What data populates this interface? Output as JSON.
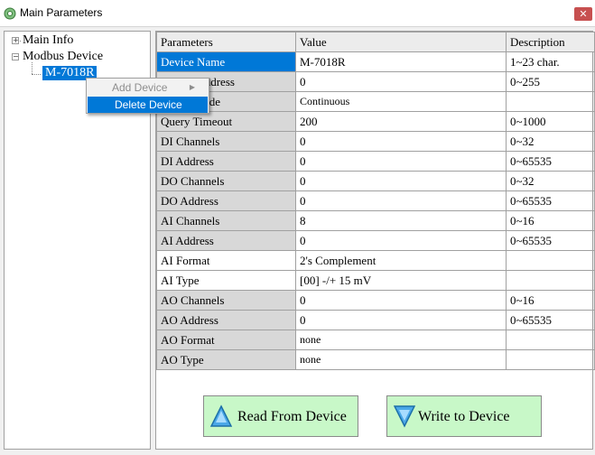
{
  "window": {
    "title": "Main Parameters",
    "close_glyph": "✕"
  },
  "tree": {
    "root_items": [
      "Main Info",
      "Modbus Device"
    ],
    "expander_collapsed": "+",
    "expander_expanded": "−",
    "selected_child": "M-7018R"
  },
  "context_menu": {
    "items": [
      {
        "label": "Add Device",
        "enabled": false,
        "submenu_arrow": "▶"
      },
      {
        "label": "Delete Device",
        "enabled": true,
        "highlighted": true
      }
    ]
  },
  "table": {
    "headers": [
      "Parameters",
      "Value",
      "Description"
    ],
    "rows": [
      {
        "param": "Device Name",
        "value": "M-7018R",
        "desc": "1~23 char."
      },
      {
        "param": "Device Address",
        "value": "0",
        "desc": "0~255"
      },
      {
        "param": "Query Mode",
        "value": "Continuous",
        "desc": ""
      },
      {
        "param": "Query Timeout",
        "value": "200",
        "desc": "0~1000"
      },
      {
        "param": "DI Channels",
        "value": "0",
        "desc": "0~32"
      },
      {
        "param": "DI Address",
        "value": "0",
        "desc": "0~65535"
      },
      {
        "param": "DO Channels",
        "value": "0",
        "desc": "0~32"
      },
      {
        "param": "DO Address",
        "value": "0",
        "desc": "0~65535"
      },
      {
        "param": "AI Channels",
        "value": "8",
        "desc": "0~16"
      },
      {
        "param": "AI Address",
        "value": "0",
        "desc": "0~65535"
      },
      {
        "param": "AI Format",
        "value": "2's Complement",
        "desc": ""
      },
      {
        "param": "AI Type",
        "value": "[00] -/+ 15 mV",
        "desc": ""
      },
      {
        "param": "AO Channels",
        "value": "0",
        "desc": "0~16"
      },
      {
        "param": "AO Address",
        "value": "0",
        "desc": "0~65535"
      },
      {
        "param": "AO Format",
        "value": "none",
        "desc": ""
      },
      {
        "param": "AO Type",
        "value": "none",
        "desc": ""
      }
    ]
  },
  "buttons": {
    "read": "Read From Device",
    "write": "Write to Device"
  },
  "colors": {
    "selection": "#0078d7",
    "button_bg": "#c8f8c8",
    "param_cell": "#d8d8d8",
    "icon_blue": "#4aa8e8"
  },
  "icons": {
    "read": "triangle-up-icon",
    "write": "triangle-down-icon",
    "app": "settings-app-icon"
  }
}
